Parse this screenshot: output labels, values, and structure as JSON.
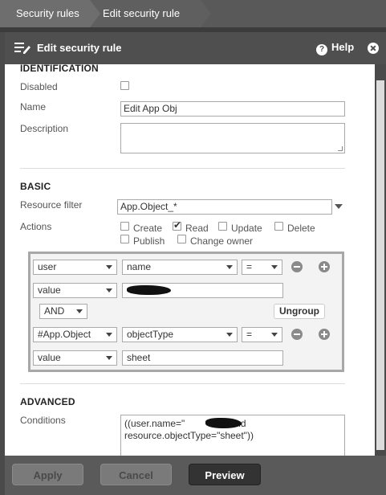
{
  "breadcrumbs": [
    "Security rules",
    "Edit security rule"
  ],
  "panel": {
    "title": "Edit security rule",
    "help_label": "Help"
  },
  "identification": {
    "heading": "IDENTIFICATION",
    "disabled_label": "Disabled",
    "disabled_checked": false,
    "name_label": "Name",
    "name_value": "Edit App Obj",
    "description_label": "Description",
    "description_value": ""
  },
  "basic": {
    "heading": "BASIC",
    "resource_filter_label": "Resource filter",
    "resource_filter_value": "App.Object_*",
    "actions_label": "Actions",
    "actions": [
      {
        "label": "Create",
        "checked": false
      },
      {
        "label": "Read",
        "checked": true
      },
      {
        "label": "Update",
        "checked": false
      },
      {
        "label": "Delete",
        "checked": false
      },
      {
        "label": "Publish",
        "checked": false
      },
      {
        "label": "Change owner",
        "checked": false
      }
    ]
  },
  "builder": {
    "row1": {
      "resource": "user",
      "attribute": "name",
      "operator": "="
    },
    "row1_value": {
      "type": "value",
      "text": ""
    },
    "conjunction": "AND",
    "ungroup_label": "Ungroup",
    "row2": {
      "resource": "#App.Object",
      "attribute": "objectType",
      "operator": "="
    },
    "row2_value": {
      "type": "value",
      "text": "sheet"
    }
  },
  "advanced": {
    "heading": "ADVANCED",
    "conditions_label": "Conditions",
    "conditions_line1_prefix": "((user.name=\"",
    "conditions_line1_suffix": "1\" and",
    "conditions_line2": "resource.objectType=\"sheet\"))"
  },
  "footer": {
    "apply_label": "Apply",
    "cancel_label": "Cancel",
    "preview_label": "Preview"
  }
}
